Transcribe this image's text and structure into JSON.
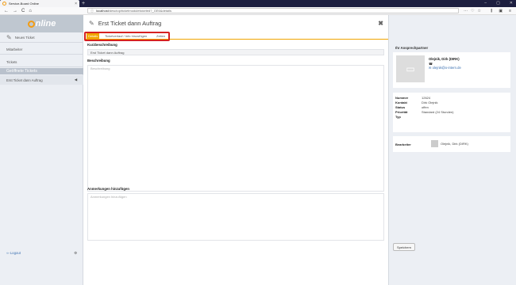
{
  "browser": {
    "tab_title": "Service-Board Online",
    "tab_close": "×",
    "new_tab": "+",
    "window_controls": [
      "–",
      "▢",
      "✕"
    ],
    "url_host": "localhost",
    "url_path": "/desctop/ticketmoduleticketed?_GE6&details",
    "nav": [
      "←",
      "→",
      "C",
      "⌂"
    ],
    "url_icons": [
      "···",
      "♡",
      "☆"
    ],
    "tool_icons": [
      "⫼",
      "▣",
      "≡"
    ]
  },
  "sidebar": {
    "logo_main": "nline",
    "logo_sub": "service-board",
    "new_ticket": "Neues Ticket",
    "staff": "Mitarbeiter",
    "tickets": "Tickets",
    "open_tickets_header": "Geöffnete Tickets",
    "open_ticket_item": "Erst Ticket dann Auftrag",
    "open_ticket_arrow": "◀",
    "logout": "Logout",
    "settings_icon": "⚙"
  },
  "main": {
    "title": "Erst Ticket dann Auftrag",
    "close": "✖",
    "tabs": [
      "Details",
      "Ticketverlauf / Info hinzufügen",
      "Zeiten"
    ],
    "short_label": "Kurzbeschreibung",
    "short_value": "Erst Ticket dann Auftrag",
    "desc_label": "Beschreibung",
    "desc_placeholder": "Beschreibung",
    "notes_label": "Anmerkungen hinzufügen",
    "notes_placeholder": "Anmerkungen hinzufügen"
  },
  "right": {
    "contact_header": "Ihr Ansprechpartner",
    "contact_name": "Olejnik, Dirk (DIRK)",
    "contact_phone": "☎",
    "contact_mail": "✉ olejnik@o-intern.de",
    "info": [
      {
        "k": "Nummer",
        "v": "12624"
      },
      {
        "k": "Kontakt",
        "v": "Dirk Olejnik"
      },
      {
        "k": "Status",
        "v": "offen"
      },
      {
        "k": "Priorität",
        "v": "Standard (24 Stunden)"
      },
      {
        "k": "Typ",
        "v": ""
      }
    ],
    "assignee_label": "Bearbeiter",
    "assignee_name": "Olejnik, Dirk (DIRK)",
    "save": "Speichern"
  },
  "colors": {
    "accent": "#f0a500",
    "highlight_border": "#d62020",
    "chrome": "#1d1f40"
  }
}
